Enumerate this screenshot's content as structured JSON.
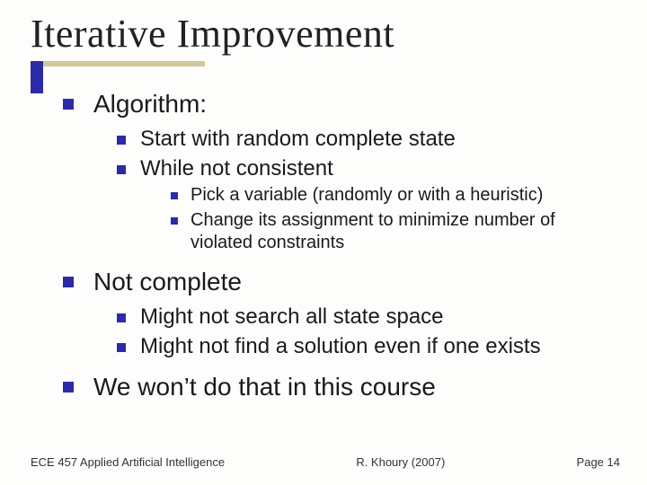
{
  "title": "Iterative Improvement",
  "colors": {
    "accent": "#2b2ba8",
    "underline": "#d0c89a"
  },
  "b": {
    "lvl1": [
      {
        "text": "Algorithm:",
        "sub": [
          {
            "text": "Start with random complete state"
          },
          {
            "text": "While not consistent",
            "sub": [
              {
                "text": "Pick a variable (randomly or with a heuristic)"
              },
              {
                "text": "Change its assignment to minimize number of violated constraints"
              }
            ]
          }
        ]
      },
      {
        "text": "Not complete",
        "sub": [
          {
            "text": "Might not search all state space"
          },
          {
            "text": "Might not find a solution even if one exists"
          }
        ]
      },
      {
        "text": "We won’t do that in this course"
      }
    ]
  },
  "footer": {
    "left": "ECE 457 Applied Artificial Intelligence",
    "center": "R. Khoury (2007)",
    "right": "Page 14"
  }
}
